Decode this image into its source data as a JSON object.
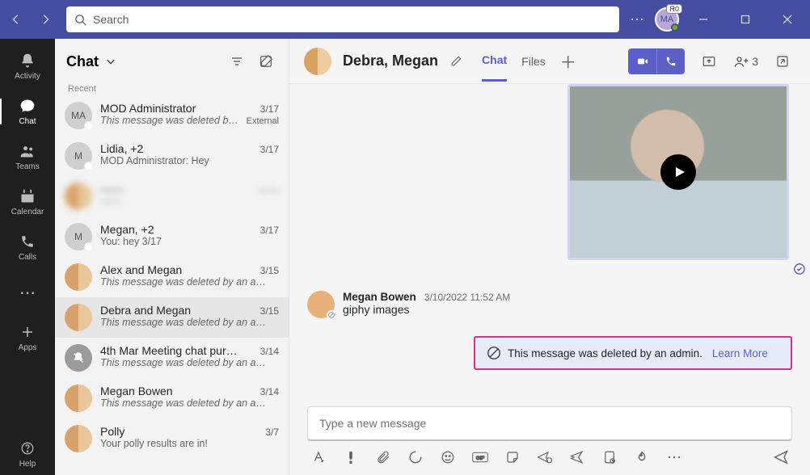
{
  "titlebar": {
    "search_placeholder": "Search",
    "avatar_initials": "MA",
    "avatar_badge": "R0"
  },
  "rail": {
    "activity": "Activity",
    "chat": "Chat",
    "teams": "Teams",
    "calendar": "Calendar",
    "calls": "Calls",
    "apps": "Apps",
    "help": "Help"
  },
  "chatlist": {
    "title": "Chat",
    "section_label": "Recent",
    "items": [
      {
        "title": "MOD Administrator",
        "date": "3/17",
        "preview": "This message was deleted by …",
        "badge": "External",
        "avatar": "MA",
        "italic": true
      },
      {
        "title": "Lidia, +2",
        "date": "3/17",
        "preview": "MOD Administrator: Hey",
        "avatar": "M",
        "italic": false
      },
      {
        "title": "——",
        "date": "——",
        "preview": "——",
        "blurred": true
      },
      {
        "title": "Megan, +2",
        "date": "3/17",
        "preview": "You: hey 3/17",
        "avatar": "M",
        "italic": false
      },
      {
        "title": "Alex and Megan",
        "date": "3/15",
        "preview": "This message was deleted by an a…",
        "italic": true
      },
      {
        "title": "Debra and Megan",
        "date": "3/15",
        "preview": "This message was deleted by an a…",
        "italic": true,
        "selected": true
      },
      {
        "title": "4th Mar Meeting chat pur…",
        "date": "3/14",
        "preview": "This message was deleted by an a…",
        "italic": true,
        "mute": true
      },
      {
        "title": "Megan Bowen",
        "date": "3/14",
        "preview": "This message was deleted by an a…",
        "italic": true
      },
      {
        "title": "Polly",
        "date": "3/7",
        "preview": "Your polly results are in!",
        "italic": false
      }
    ]
  },
  "conversation": {
    "title": "Debra, Megan",
    "tabs": {
      "chat": "Chat",
      "files": "Files"
    },
    "participants_count": "3",
    "message": {
      "author": "Megan Bowen",
      "timestamp": "3/10/2022 11:52 AM",
      "text": "giphy images"
    },
    "deleted_banner": {
      "text": "This message was deleted by an admin.",
      "learn_more": "Learn More"
    },
    "composer_placeholder": "Type a new message"
  }
}
